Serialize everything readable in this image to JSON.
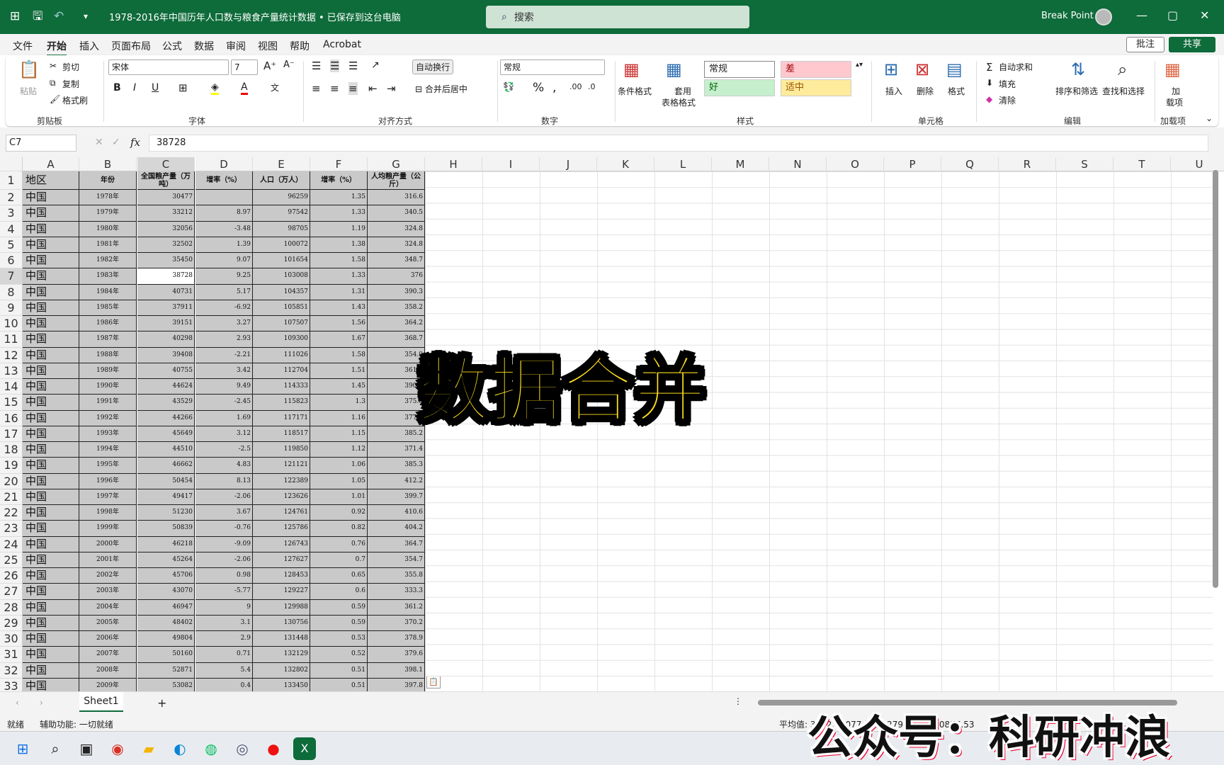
{
  "app": {
    "title": "1978-2016年中国历年人口数与粮食产量统计数据 • 已保存到这台电脑",
    "search_placeholder": "搜索",
    "user": "Break Point"
  },
  "menu": [
    "文件",
    "开始",
    "插入",
    "页面布局",
    "公式",
    "数据",
    "审阅",
    "视图",
    "帮助",
    "Acrobat"
  ],
  "menu_active": "开始",
  "actions": {
    "comment": "批注",
    "share": "共享"
  },
  "ribbon": {
    "clipboard": {
      "paste": "粘贴",
      "cut": "剪切",
      "copy": "复制",
      "format_painter": "格式刷",
      "label": "剪贴板"
    },
    "font": {
      "name": "宋体",
      "size": "7",
      "label": "字体"
    },
    "align": {
      "wrap": "自动换行",
      "merge": "合并后居中",
      "label": "对齐方式"
    },
    "number": {
      "format": "常规",
      "label": "数字"
    },
    "styles": {
      "conditional": "条件格式",
      "table_fmt_1": "套用",
      "table_fmt_2": "表格格式",
      "normal": "常规",
      "bad": "差",
      "good": "好",
      "neutral": "适中",
      "label": "样式"
    },
    "cells": {
      "insert": "插入",
      "delete": "删除",
      "format": "格式",
      "label": "单元格"
    },
    "edit": {
      "autosum": "自动求和",
      "fill": "填充",
      "clear": "清除",
      "sort": "排序和筛选",
      "find": "查找和选择",
      "label": "编辑"
    },
    "addins": {
      "l1": "加",
      "l2": "载项",
      "label": "加载项"
    }
  },
  "formula": {
    "namebox": "C7",
    "value": "38728"
  },
  "columns": [
    "A",
    "B",
    "C",
    "D",
    "E",
    "F",
    "G",
    "H",
    "I",
    "J",
    "K",
    "L",
    "M",
    "N",
    "O",
    "P",
    "Q",
    "R",
    "S",
    "T",
    "U"
  ],
  "header_row": [
    "地区",
    "年份",
    "全国粮产量（万吨）",
    "增率（%）",
    "人口（万人）",
    "增率（%）",
    "人均粮产量（公斤）"
  ],
  "rows": [
    [
      "中国",
      "1978年",
      "30477",
      "",
      "96259",
      "1.35",
      "316.6"
    ],
    [
      "中国",
      "1979年",
      "33212",
      "8.97",
      "97542",
      "1.33",
      "340.5"
    ],
    [
      "中国",
      "1980年",
      "32056",
      "-3.48",
      "98705",
      "1.19",
      "324.8"
    ],
    [
      "中国",
      "1981年",
      "32502",
      "1.39",
      "100072",
      "1.38",
      "324.8"
    ],
    [
      "中国",
      "1982年",
      "35450",
      "9.07",
      "101654",
      "1.58",
      "348.7"
    ],
    [
      "中国",
      "1983年",
      "38728",
      "9.25",
      "103008",
      "1.33",
      "376"
    ],
    [
      "中国",
      "1984年",
      "40731",
      "5.17",
      "104357",
      "1.31",
      "390.3"
    ],
    [
      "中国",
      "1985年",
      "37911",
      "-6.92",
      "105851",
      "1.43",
      "358.2"
    ],
    [
      "中国",
      "1986年",
      "39151",
      "3.27",
      "107507",
      "1.56",
      "364.2"
    ],
    [
      "中国",
      "1987年",
      "40298",
      "2.93",
      "109300",
      "1.67",
      "368.7"
    ],
    [
      "中国",
      "1988年",
      "39408",
      "-2.21",
      "111026",
      "1.58",
      "354.9"
    ],
    [
      "中国",
      "1989年",
      "40755",
      "3.42",
      "112704",
      "1.51",
      "361.6"
    ],
    [
      "中国",
      "1990年",
      "44624",
      "9.49",
      "114333",
      "1.45",
      "390.3"
    ],
    [
      "中国",
      "1991年",
      "43529",
      "-2.45",
      "115823",
      "1.3",
      "375.8"
    ],
    [
      "中国",
      "1992年",
      "44266",
      "1.69",
      "117171",
      "1.16",
      "377.8"
    ],
    [
      "中国",
      "1993年",
      "45649",
      "3.12",
      "118517",
      "1.15",
      "385.2"
    ],
    [
      "中国",
      "1994年",
      "44510",
      "-2.5",
      "119850",
      "1.12",
      "371.4"
    ],
    [
      "中国",
      "1995年",
      "46662",
      "4.83",
      "121121",
      "1.06",
      "385.3"
    ],
    [
      "中国",
      "1996年",
      "50454",
      "8.13",
      "122389",
      "1.05",
      "412.2"
    ],
    [
      "中国",
      "1997年",
      "49417",
      "-2.06",
      "123626",
      "1.01",
      "399.7"
    ],
    [
      "中国",
      "1998年",
      "51230",
      "3.67",
      "124761",
      "0.92",
      "410.6"
    ],
    [
      "中国",
      "1999年",
      "50839",
      "-0.76",
      "125786",
      "0.82",
      "404.2"
    ],
    [
      "中国",
      "2000年",
      "46218",
      "-9.09",
      "126743",
      "0.76",
      "364.7"
    ],
    [
      "中国",
      "2001年",
      "45264",
      "-2.06",
      "127627",
      "0.7",
      "354.7"
    ],
    [
      "中国",
      "2002年",
      "45706",
      "0.98",
      "128453",
      "0.65",
      "355.8"
    ],
    [
      "中国",
      "2003年",
      "43070",
      "-5.77",
      "129227",
      "0.6",
      "333.3"
    ],
    [
      "中国",
      "2004年",
      "46947",
      "9",
      "129988",
      "0.59",
      "361.2"
    ],
    [
      "中国",
      "2005年",
      "48402",
      "3.1",
      "130756",
      "0.59",
      "370.2"
    ],
    [
      "中国",
      "2006年",
      "49804",
      "2.9",
      "131448",
      "0.53",
      "378.9"
    ],
    [
      "中国",
      "2007年",
      "50160",
      "0.71",
      "132129",
      "0.52",
      "379.6"
    ],
    [
      "中国",
      "2008年",
      "52871",
      "5.4",
      "132802",
      "0.51",
      "398.1"
    ],
    [
      "中国",
      "2009年",
      "53082",
      "0.4",
      "133450",
      "0.51",
      "397.8"
    ]
  ],
  "overlay": "数据合并",
  "sheet": {
    "tab": "Sheet1",
    "add": "+"
  },
  "status": {
    "ready": "就绪",
    "accessibility": "辅助功能: 一切就绪",
    "average": "平均值: 3662.77077 计数: 279 求和: 530877.53"
  },
  "watermark": "公众号：科研冲浪",
  "colors": {
    "brand": "#0e6b3a",
    "overlay": "#ffe01b",
    "bad_bg": "#ffc7ce",
    "good_bg": "#c6efce",
    "neutral_bg": "#ffeb9c"
  }
}
